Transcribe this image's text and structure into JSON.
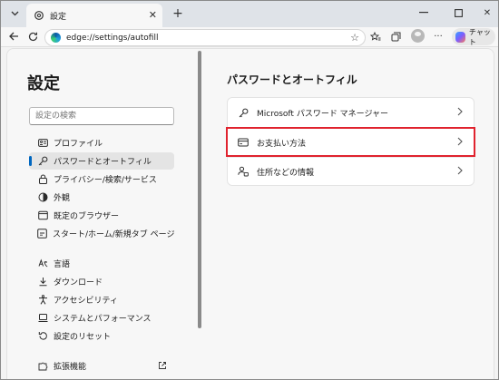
{
  "browser": {
    "tab_title": "設定",
    "url": "edge://settings/autofill",
    "copilot_label": "チャット"
  },
  "sidebar": {
    "title": "設定",
    "search_placeholder": "設定の検索",
    "items": [
      {
        "label": "プロファイル",
        "icon": "profile-icon"
      },
      {
        "label": "パスワードとオートフィル",
        "icon": "key-icon",
        "active": true
      },
      {
        "label": "プライバシー/検索/サービス",
        "icon": "lock-icon"
      },
      {
        "label": "外観",
        "icon": "appearance-icon"
      },
      {
        "label": "既定のブラウザー",
        "icon": "browser-icon"
      },
      {
        "label": "スタート/ホーム/新規タブ ページ",
        "icon": "home-icon"
      },
      {
        "label": "言語",
        "icon": "language-icon"
      },
      {
        "label": "ダウンロード",
        "icon": "download-icon"
      },
      {
        "label": "アクセシビリティ",
        "icon": "accessibility-icon"
      },
      {
        "label": "システムとパフォーマンス",
        "icon": "laptop-icon"
      },
      {
        "label": "設定のリセット",
        "icon": "reset-icon"
      },
      {
        "label": "拡張機能",
        "icon": "extension-icon"
      }
    ]
  },
  "main": {
    "title": "パスワードとオートフィル",
    "rows": [
      {
        "label": "Microsoft パスワード マネージャー",
        "icon": "key-icon"
      },
      {
        "label": "お支払い方法",
        "icon": "card-icon"
      },
      {
        "label": "住所などの情報",
        "icon": "contact-icon"
      }
    ]
  },
  "colors": {
    "accent": "#0067c0",
    "highlight": "#e0232e"
  }
}
